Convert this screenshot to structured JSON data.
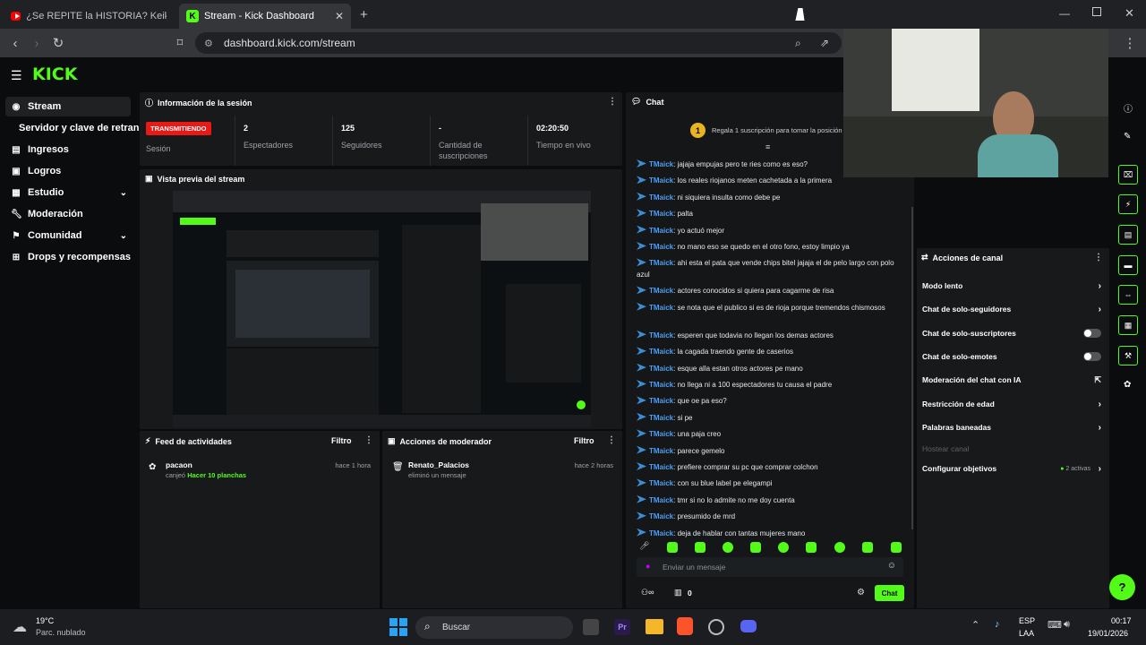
{
  "browser": {
    "tabs": [
      {
        "label": "¿Se REPITE la HISTORIA? Keiko y Lóp"
      },
      {
        "label": "Stream - Kick Dashboard"
      }
    ],
    "url": "dashboard.kick.com/stream"
  },
  "logo": "KICK",
  "sidebar": {
    "items": [
      {
        "label": "Stream",
        "icon": "stream-icon"
      },
      {
        "label": "Servidor y clave de retransm"
      },
      {
        "label": "Ingresos",
        "icon": "income-icon"
      },
      {
        "label": "Logros",
        "icon": "achievements-icon"
      },
      {
        "label": "Estudio",
        "icon": "studio-icon"
      },
      {
        "label": "Moderación",
        "icon": "moderation-icon"
      },
      {
        "label": "Comunidad",
        "icon": "community-icon"
      },
      {
        "label": "Drops y recompensas",
        "icon": "drops-icon"
      }
    ]
  },
  "session": {
    "title": "Información de la sesión",
    "live_badge": "TRANSMITIENDO",
    "session_label": "Sesión",
    "stats": [
      {
        "value": "2",
        "label": "Espectadores"
      },
      {
        "value": "125",
        "label": "Seguidores"
      },
      {
        "value": "-",
        "label": "Cantidad de suscripciones"
      },
      {
        "value": "02:20:50",
        "label": "Tiempo en vivo"
      }
    ]
  },
  "preview": {
    "title": "Vista previa del stream"
  },
  "activity": {
    "title": "Feed de actividades",
    "filter": "Filtro",
    "item": {
      "user": "pacaon",
      "action": "canjeó",
      "reward": "Hacer 10 planchas",
      "time": "hace 1 hora"
    }
  },
  "modactions": {
    "title": "Acciones de moderador",
    "filter": "Filtro",
    "item": {
      "user": "Renato_Palacios",
      "action": "eliminó un mensaje",
      "time": "hace 2 horas"
    }
  },
  "chat": {
    "title": "Chat",
    "pinned": "Regala 1 suscripción para tomar la posición",
    "pinned_rank": "1",
    "messages": [
      {
        "user": "TMaick",
        "text": "jajaja empujas pero te ries como es eso?"
      },
      {
        "user": "TMaick",
        "text": "los reales riojanos meten cachetada a la primera"
      },
      {
        "user": "TMaick",
        "text": "ni siquiera insulta como debe pe"
      },
      {
        "user": "TMaick",
        "text": "palta"
      },
      {
        "user": "TMaick",
        "text": "yo actuó mejor"
      },
      {
        "user": "TMaick",
        "text": "no mano eso se quedo en el otro fono, estoy limpio ya"
      },
      {
        "user": "TMaick",
        "text": "ahi esta el pata que vende chips bitel jajaja el de pelo largo con polo azul"
      },
      {
        "user": "TMaick",
        "text": "actores conocidos si quiera para cagarme de risa"
      },
      {
        "user": "TMaick",
        "text": "se nota que el publico si es de rioja porque tremendos chismosos"
      },
      {
        "user": "TMaick",
        "text": "esperen que todavia no llegan los demas actores"
      },
      {
        "user": "TMaick",
        "text": "la cagada traendo gente de caserios"
      },
      {
        "user": "TMaick",
        "text": "esque alla estan otros actores pe mano"
      },
      {
        "user": "TMaick",
        "text": "no llega ni a 100 espectadores tu causa el padre"
      },
      {
        "user": "TMaick",
        "text": "que oe pa eso?"
      },
      {
        "user": "TMaick",
        "text": "si pe"
      },
      {
        "user": "TMaick",
        "text": "una paja creo"
      },
      {
        "user": "TMaick",
        "text": "parece gemelo"
      },
      {
        "user": "TMaick",
        "text": "prefiere comprar su pc que comprar colchon"
      },
      {
        "user": "TMaick",
        "text": "con su blue label pe elegampi"
      },
      {
        "user": "TMaick",
        "text": "tmr si no lo admite no me doy cuenta"
      },
      {
        "user": "TMaick",
        "text": "presumido de mrd"
      },
      {
        "user": "TMaick",
        "text": "deja de hablar con tantas mujeres mano"
      }
    ],
    "input_placeholder": "Enviar un mensaje",
    "send_label": "Chat",
    "points": "0"
  },
  "channel_actions": {
    "title": "Acciones de canal",
    "rows": [
      {
        "label": "Modo lento",
        "control": "arrow"
      },
      {
        "label": "Chat de solo-seguidores",
        "control": "arrow"
      },
      {
        "label": "Chat de solo-suscriptores",
        "control": "toggle"
      },
      {
        "label": "Chat de solo-emotes",
        "control": "toggle"
      },
      {
        "label": "Moderación del chat con IA",
        "control": "external"
      },
      {
        "label": "Restricción de edad",
        "control": "arrow"
      },
      {
        "label": "Palabras baneadas",
        "control": "arrow"
      },
      {
        "label": "Hostear canal",
        "control": "none",
        "disabled": true
      },
      {
        "label": "Configurar objetivos",
        "control": "arrow",
        "extra": "2 activas"
      }
    ]
  },
  "taskbar": {
    "weather_temp": "19°C",
    "weather_desc": "Parc. nublado",
    "search": "Buscar",
    "lang1": "ESP",
    "lang2": "LAA",
    "time": "00:17",
    "date": "19/01/2026"
  },
  "colors": {
    "accent": "#53fc18",
    "live": "#e91916",
    "chat_user": "#4d9ef6"
  }
}
